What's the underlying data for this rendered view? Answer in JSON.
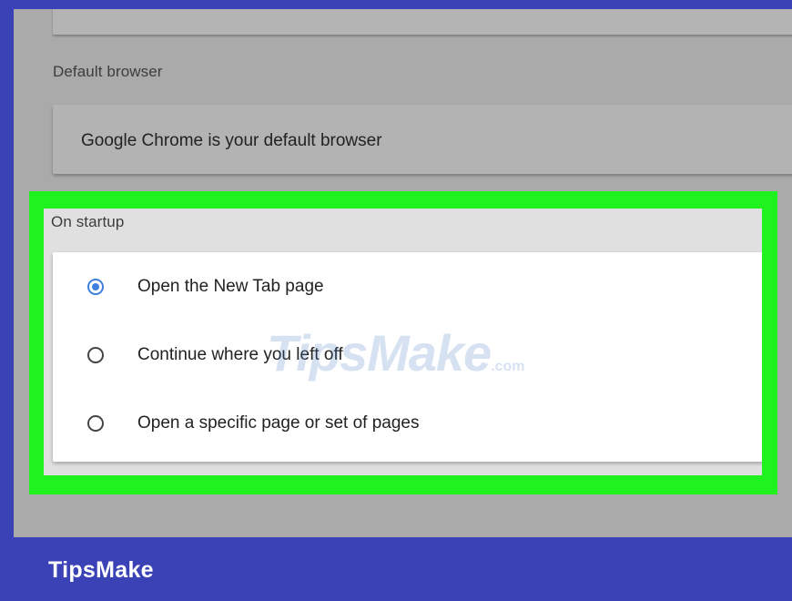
{
  "settings": {
    "default_browser": {
      "section_label": "Default browser",
      "status_text": "Google Chrome is your default browser"
    },
    "on_startup": {
      "section_label": "On startup",
      "options": [
        {
          "label": "Open the New Tab page",
          "selected": true
        },
        {
          "label": "Continue where you left off",
          "selected": false
        },
        {
          "label": "Open a specific page or set of pages",
          "selected": false
        }
      ]
    }
  },
  "watermark": {
    "text": "TipsMake",
    "suffix": ".com"
  },
  "footer": {
    "brand": "TipsMake"
  },
  "colors": {
    "frame": "#3b42b5",
    "highlight": "#1ff21f",
    "radio_selected": "#3f7fe0"
  }
}
